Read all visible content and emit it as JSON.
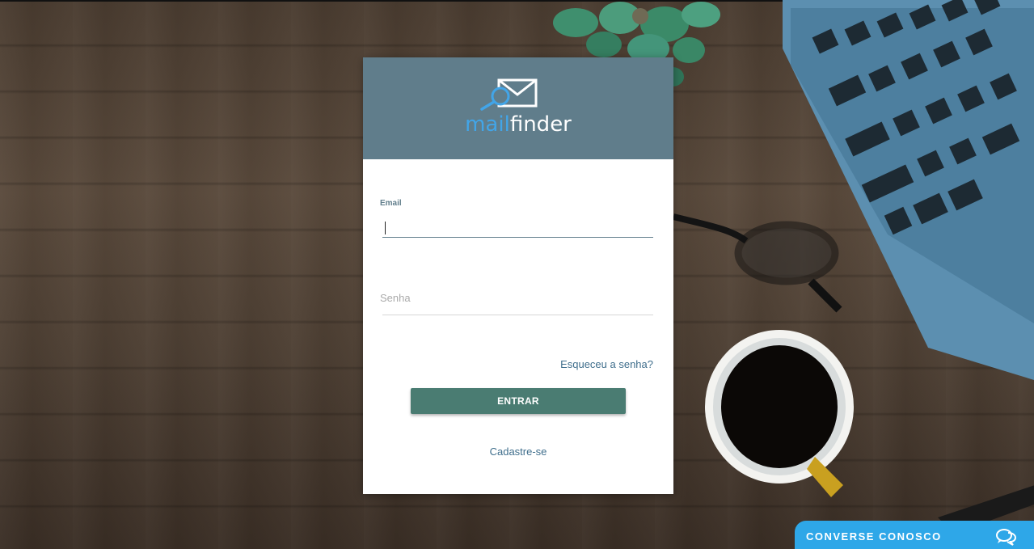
{
  "logo": {
    "part1": "mail",
    "part2": "finder",
    "icon": "envelope-magnifier-icon"
  },
  "form": {
    "email_label": "Email",
    "email_value": "",
    "password_placeholder": "Senha",
    "password_value": "",
    "forgot_link": "Esqueceu a senha?",
    "submit_label": "ENTRAR",
    "signup_link": "Cadastre-se"
  },
  "chat": {
    "label": "CONVERSE CONOSCO",
    "icon": "chat-bubbles-icon"
  },
  "colors": {
    "header": "#607d8b",
    "accent_blue": "#42a5e8",
    "button": "#4a7c72",
    "link": "#3f6e8c",
    "chat": "#2ea7e8"
  }
}
